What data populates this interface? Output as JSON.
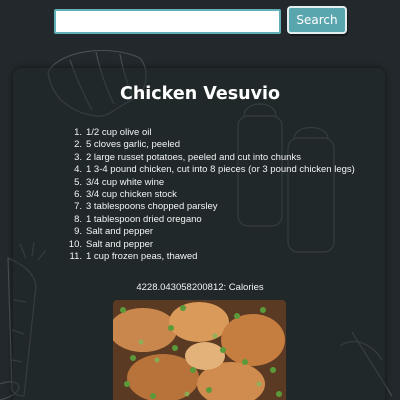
{
  "search": {
    "placeholder": "",
    "value": "",
    "button_label": "Search"
  },
  "recipe": {
    "title": "Chicken Vesuvio",
    "ingredients": [
      "1/2 cup olive oil",
      "5 cloves garlic, peeled",
      "2 large russet potatoes, peeled and cut into chunks",
      "1 3-4 pound chicken, cut into 8 pieces (or 3 pound chicken legs)",
      "3/4 cup white wine",
      "3/4 cup chicken stock",
      "3 tablespoons chopped parsley",
      "1 tablespoon dried oregano",
      "Salt and pepper",
      "Salt and pepper",
      "1 cup frozen peas, thawed"
    ],
    "calories_text": "4228.043058200812: Calories"
  },
  "colors": {
    "background": "#22282b",
    "accent": "#5aa6ae",
    "text": "#f2f4f5"
  }
}
